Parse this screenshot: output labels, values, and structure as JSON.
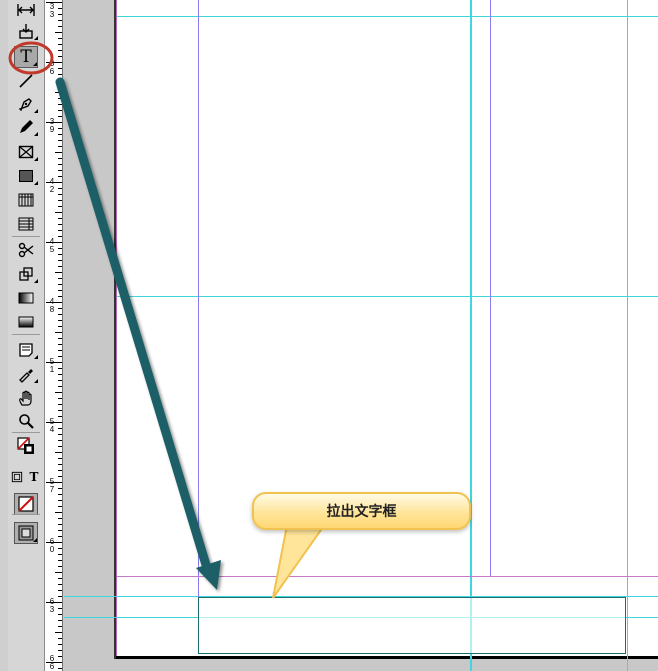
{
  "toolbar": {
    "tools": [
      {
        "name": "gap-tool-icon"
      },
      {
        "name": "content-collector-icon"
      },
      {
        "name": "type-tool-icon",
        "glyph": "T",
        "selected": true
      },
      {
        "name": "line-tool-icon"
      },
      {
        "name": "pen-tool-icon"
      },
      {
        "name": "pencil-tool-icon"
      },
      {
        "name": "rectangle-frame-tool-icon"
      },
      {
        "name": "rectangle-tool-icon"
      },
      {
        "name": "horizontal-grid-tool-icon"
      },
      {
        "name": "vertical-grid-tool-icon"
      },
      {
        "name": "scissors-tool-icon"
      },
      {
        "name": "free-transform-tool-icon"
      },
      {
        "name": "gradient-swatch-tool-icon"
      },
      {
        "name": "gradient-feather-tool-icon"
      },
      {
        "name": "note-tool-icon"
      },
      {
        "name": "eyedropper-tool-icon"
      },
      {
        "name": "hand-tool-icon"
      },
      {
        "name": "zoom-tool-icon"
      },
      {
        "name": "fill-stroke-icon"
      },
      {
        "name": "formatting-affects-container-icon"
      },
      {
        "name": "formatting-affects-text-icon",
        "glyph": "T"
      },
      {
        "name": "apply-none-icon"
      },
      {
        "name": "screen-mode-icon"
      }
    ]
  },
  "ruler": {
    "labels": [
      {
        "text": "3\n3"
      },
      {
        "text": "3\n6"
      },
      {
        "text": "3\n9"
      },
      {
        "text": "4\n2"
      },
      {
        "text": "4\n5"
      },
      {
        "text": "4\n8"
      },
      {
        "text": "5\n1"
      },
      {
        "text": "5\n4"
      },
      {
        "text": "5\n7"
      },
      {
        "text": "6\n0"
      },
      {
        "text": "6\n3"
      },
      {
        "text": "6\n6"
      }
    ]
  },
  "callout": {
    "text": "拉出文字框"
  },
  "colors": {
    "guide_cyan": "#3fd6dd",
    "guide_purple": "#8a7cf0",
    "margin_magenta": "#c27ac9",
    "arrow_teal": "#1f5e66",
    "highlight_red": "#c0392b",
    "callout_yellow": "#ffe59a"
  }
}
